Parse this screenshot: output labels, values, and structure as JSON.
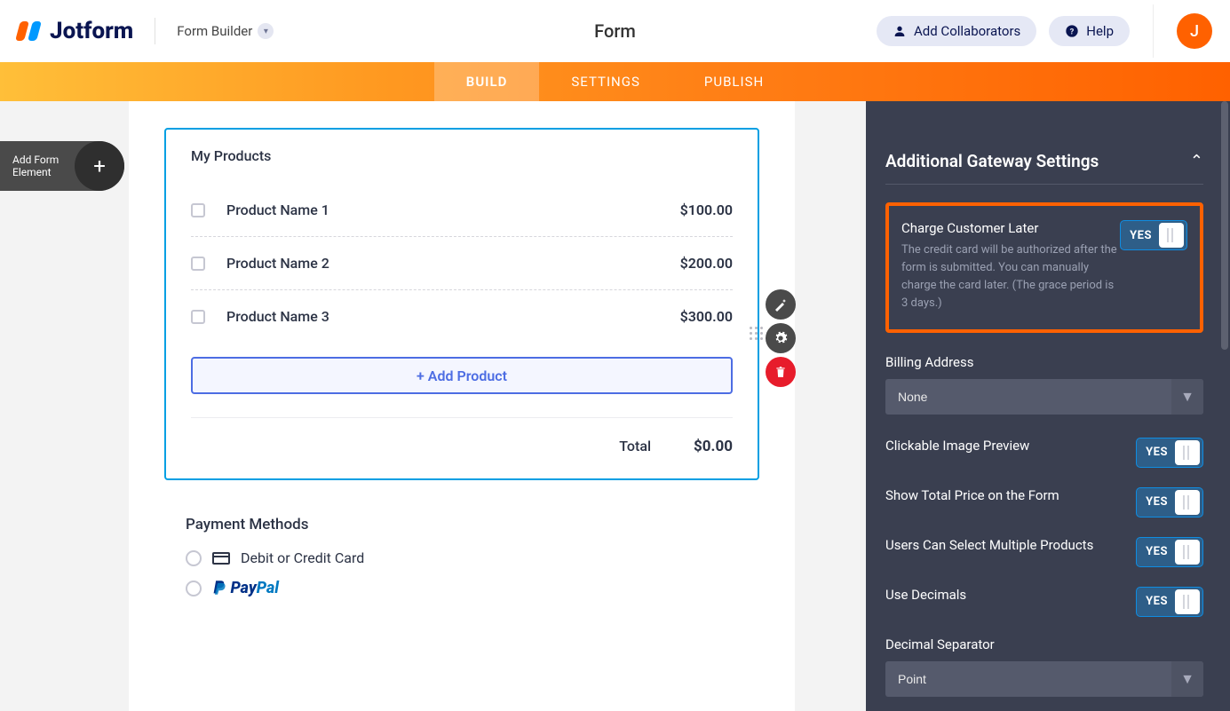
{
  "header": {
    "brand": "Jotform",
    "form_builder_label": "Form Builder",
    "center_title": "Form",
    "add_collaborators": "Add Collaborators",
    "help": "Help",
    "avatar_letter": "J"
  },
  "nav": {
    "build": "BUILD",
    "settings": "SETTINGS",
    "publish": "PUBLISH"
  },
  "sidebar": {
    "add_form_element_line1": "Add Form",
    "add_form_element_line2": "Element"
  },
  "products": {
    "title": "My Products",
    "items": [
      {
        "name": "Product Name 1",
        "price": "$100.00"
      },
      {
        "name": "Product Name 2",
        "price": "$200.00"
      },
      {
        "name": "Product Name 3",
        "price": "$300.00"
      }
    ],
    "add_product": "+ Add Product",
    "total_label": "Total",
    "total_value": "$0.00"
  },
  "payment_methods": {
    "title": "Payment Methods",
    "debit_credit": "Debit or Credit Card",
    "paypal_pay": "Pay",
    "paypal_pal": "Pal"
  },
  "panel": {
    "title": "Additional Gateway Settings",
    "charge_later": {
      "label": "Charge Customer Later",
      "desc": "The credit card will be authorized after the form is submitted. You can manually charge the card later. (The grace period is 3 days.)",
      "value": "YES"
    },
    "billing_address": {
      "label": "Billing Address",
      "value": "None"
    },
    "clickable_preview": {
      "label": "Clickable Image Preview",
      "value": "YES"
    },
    "show_total": {
      "label": "Show Total Price on the Form",
      "value": "YES"
    },
    "multi_products": {
      "label": "Users Can Select Multiple Products",
      "value": "YES"
    },
    "use_decimals": {
      "label": "Use Decimals",
      "value": "YES"
    },
    "decimal_separator": {
      "label": "Decimal Separator",
      "value": "Point"
    }
  }
}
